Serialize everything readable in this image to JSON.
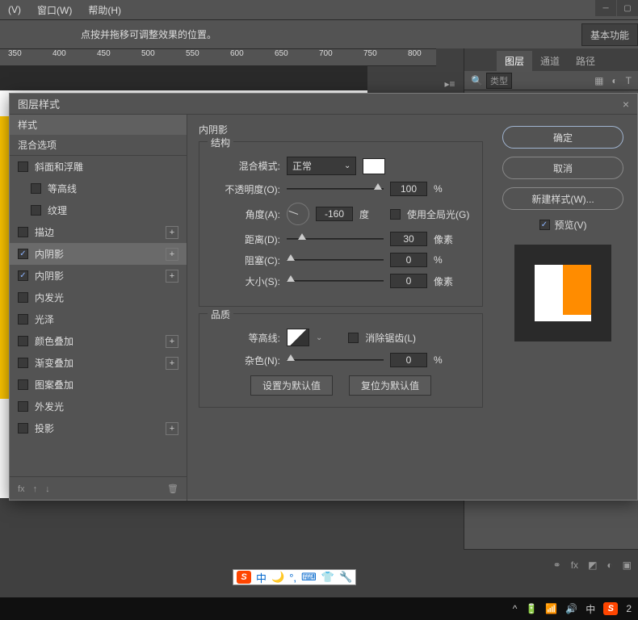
{
  "menu": {
    "v": "(V)",
    "window": "窗口(W)",
    "help": "帮助(H)"
  },
  "toolbar": {
    "hint": "点按并拖移可调整效果的位置。",
    "right_label": "基本功能"
  },
  "ruler": [
    "350",
    "400",
    "450",
    "500",
    "550",
    "600",
    "650",
    "700",
    "750",
    "800"
  ],
  "panels": {
    "tabs": {
      "layers": "图层",
      "channels": "通道",
      "paths": "路径"
    },
    "search": "类型"
  },
  "dialog": {
    "title": "图层样式",
    "styles_header": "样式",
    "blend_header": "混合选项",
    "style_items": [
      {
        "label": "斜面和浮雕",
        "checked": false,
        "sub": false,
        "plus": false
      },
      {
        "label": "等高线",
        "checked": false,
        "sub": true,
        "plus": false
      },
      {
        "label": "纹理",
        "checked": false,
        "sub": true,
        "plus": false
      },
      {
        "label": "描边",
        "checked": false,
        "sub": false,
        "plus": true
      },
      {
        "label": "内阴影",
        "checked": true,
        "sub": false,
        "plus": true,
        "selected": true
      },
      {
        "label": "内阴影",
        "checked": true,
        "sub": false,
        "plus": true
      },
      {
        "label": "内发光",
        "checked": false,
        "sub": false,
        "plus": false
      },
      {
        "label": "光泽",
        "checked": false,
        "sub": false,
        "plus": false
      },
      {
        "label": "颜色叠加",
        "checked": false,
        "sub": false,
        "plus": true
      },
      {
        "label": "渐变叠加",
        "checked": false,
        "sub": false,
        "plus": true
      },
      {
        "label": "图案叠加",
        "checked": false,
        "sub": false,
        "plus": false
      },
      {
        "label": "外发光",
        "checked": false,
        "sub": false,
        "plus": false
      },
      {
        "label": "投影",
        "checked": false,
        "sub": false,
        "plus": true
      }
    ],
    "fx_label": "fx",
    "section": "内阴影",
    "structure": "结构",
    "blend_mode_label": "混合模式:",
    "blend_mode_value": "正常",
    "opacity_label": "不透明度(O):",
    "opacity_value": "100",
    "percent": "%",
    "angle_label": "角度(A):",
    "angle_value": "-160",
    "degree": "度",
    "global_light": "使用全局光(G)",
    "distance_label": "距离(D):",
    "distance_value": "30",
    "px": "像素",
    "choke_label": "阻塞(C):",
    "choke_value": "0",
    "size_label": "大小(S):",
    "size_value": "0",
    "quality": "品质",
    "contour_label": "等高线:",
    "antialias": "消除锯齿(L)",
    "noise_label": "杂色(N):",
    "noise_value": "0",
    "set_default": "设置为默认值",
    "reset_default": "复位为默认值",
    "ok": "确定",
    "cancel": "取消",
    "new_style": "新建样式(W)...",
    "preview": "预览(V)"
  },
  "ime": {
    "s": "S",
    "zhong": "中"
  },
  "taskbar": {
    "lang": "中",
    "s": "S",
    "time": "2"
  }
}
